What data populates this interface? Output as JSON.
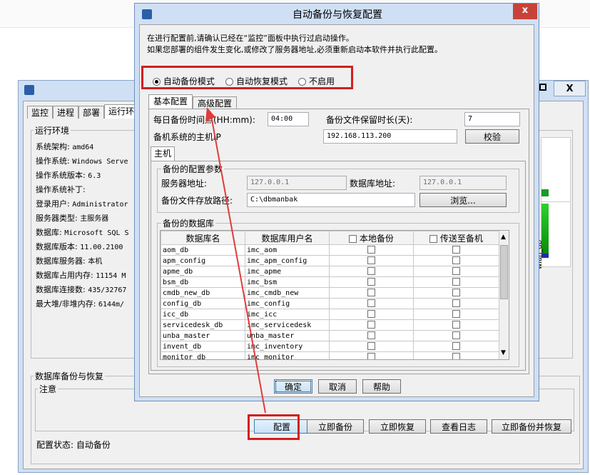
{
  "bg_window": {
    "tabs": [
      "监控",
      "进程",
      "部署",
      "运行环境"
    ],
    "close_label": "X",
    "runtime_group": "运行环境",
    "info": [
      {
        "label": "系统架构:",
        "value": "amd64"
      },
      {
        "label": "操作系统:",
        "value": "Windows Serve"
      },
      {
        "label": "操作系统版本:",
        "value": "6.3"
      },
      {
        "label": "操作系统补丁:",
        "value": ""
      },
      {
        "label": "登录用户:",
        "value": "Administrator"
      },
      {
        "label": "服务器类型:",
        "value": "主服务器"
      },
      {
        "label": "数据库:",
        "value": "Microsoft SQL S"
      },
      {
        "label": "数据库版本:",
        "value": "11.00.2100"
      },
      {
        "label": "数据库服务器:",
        "value": "本机"
      },
      {
        "label": "数据库占用内存:",
        "value": "11154 M"
      },
      {
        "label": "数据库连接数:",
        "value": "435/32767"
      },
      {
        "label": "最大堆/非堆内存:",
        "value": "6144m/"
      }
    ],
    "backup_group": "数据库备份与恢复",
    "note_group": "注意",
    "buttons": {
      "config": "配置",
      "backup_now": "立即备份",
      "restore_now": "立即恢复",
      "view_log": "查看日志",
      "backup_restore": "立即备份并恢复"
    },
    "status": "配置状态: 自动备份",
    "chart_label": "wlan_db"
  },
  "dialog": {
    "title": "自动备份与恢复配置",
    "close_label": "x",
    "intro_line1": "在进行配置前,请确认已经在“监控”面板中执行过启动操作。",
    "intro_line2": "如果您部署的组件发生变化,或修改了服务器地址,必须重新启动本软件并执行此配置。",
    "modes": [
      "自动备份模式",
      "自动恢复模式",
      "不启用"
    ],
    "tabs": [
      "基本配置",
      "高级配置"
    ],
    "daily_time_label": "每日备份时间点(HH:mm):",
    "daily_time_value": "04:00",
    "retention_label": "备份文件保留时长(天):",
    "retention_value": "7",
    "standby_ip_label": "备机系统的主机IP",
    "standby_ip_value": "192.168.113.200",
    "verify_button": "校验",
    "host_tab": "主机",
    "params_group": "备份的配置参数",
    "server_addr_label": "服务器地址:",
    "server_addr_value": "127.0.0.1",
    "db_addr_label": "数据库地址:",
    "db_addr_value": "127.0.0.1",
    "path_label": "备份文件存放路径:",
    "path_value": "C:\\dbmanbak",
    "browse_button": "浏览...",
    "db_group": "备份的数据库",
    "table_headers": [
      "数据库名",
      "数据库用户名",
      "本地备份",
      "传送至备机"
    ],
    "rows": [
      [
        "aom_db",
        "imc_aom"
      ],
      [
        "apm_config",
        "imc_apm_config"
      ],
      [
        "apme_db",
        "imc_apme"
      ],
      [
        "bsm_db",
        "imc_bsm"
      ],
      [
        "cmdb_new_db",
        "imc_cmdb_new"
      ],
      [
        "config_db",
        "imc_config"
      ],
      [
        "icc_db",
        "imc_icc"
      ],
      [
        "servicedesk_db",
        "imc_servicedesk"
      ],
      [
        "unba_master",
        "unba_master"
      ],
      [
        "invent_db",
        "imc_inventory"
      ],
      [
        "monitor_db",
        "imc_monitor"
      ]
    ],
    "ok_button": "确定",
    "cancel_button": "取消",
    "help_button": "帮助"
  }
}
